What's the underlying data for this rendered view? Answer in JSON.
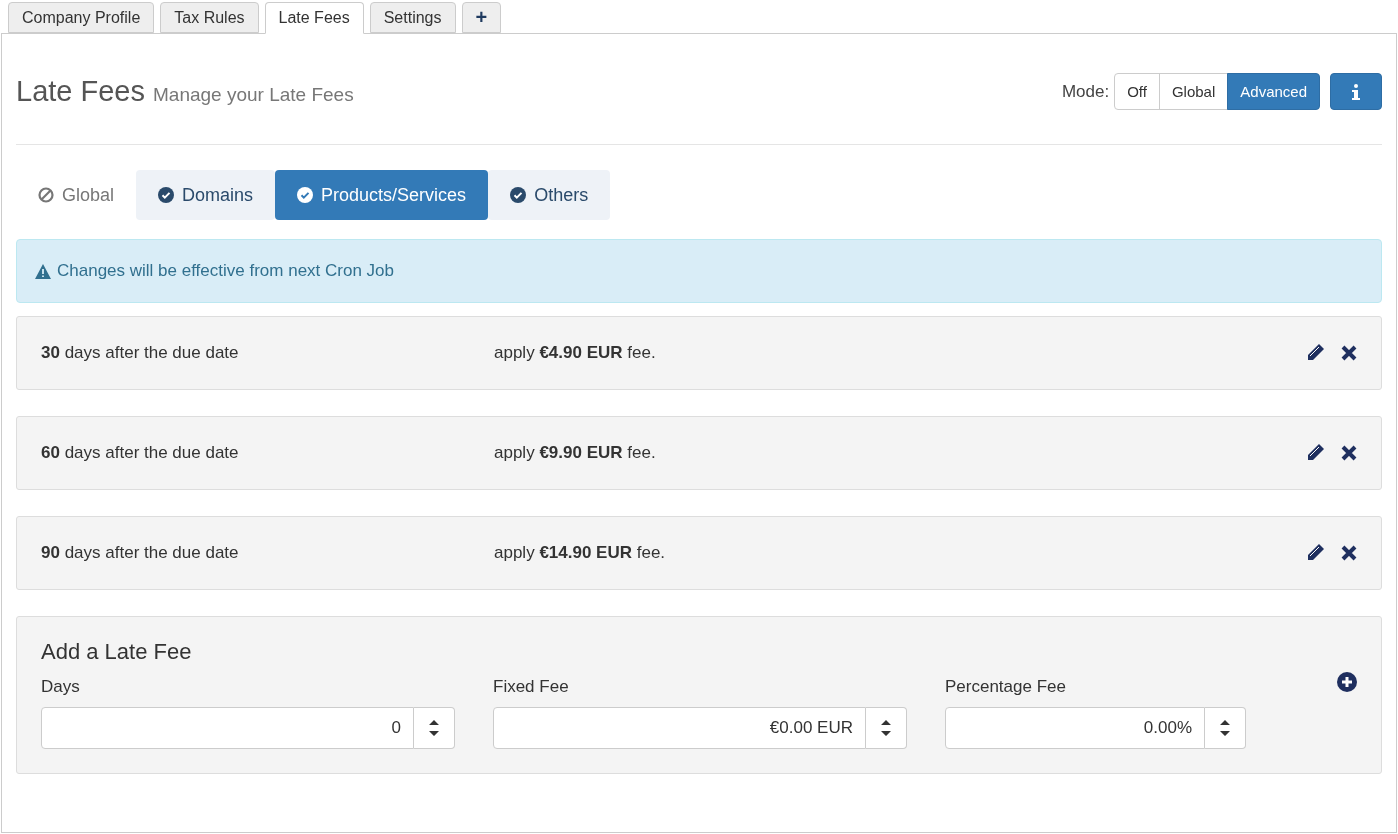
{
  "page_tabs": [
    {
      "label": "Company Profile",
      "selected": false
    },
    {
      "label": "Tax Rules",
      "selected": false
    },
    {
      "label": "Late Fees",
      "selected": true
    },
    {
      "label": "Settings",
      "selected": false
    },
    {
      "label": "+",
      "selected": false
    }
  ],
  "header": {
    "title": "Late Fees",
    "subtitle": "Manage your Late Fees",
    "mode_label": "Mode:",
    "modes": [
      {
        "label": "Off",
        "selected": false
      },
      {
        "label": "Global",
        "selected": false
      },
      {
        "label": "Advanced",
        "selected": true
      }
    ]
  },
  "sub_tabs": [
    {
      "label": "Global",
      "enabled": false,
      "selected": false
    },
    {
      "label": "Domains",
      "enabled": true,
      "selected": false
    },
    {
      "label": "Products/Services",
      "enabled": true,
      "selected": true
    },
    {
      "label": "Others",
      "enabled": true,
      "selected": false
    }
  ],
  "alert": "Changes will be effective from next Cron Job",
  "fees": [
    {
      "days": "**30** days after the due date",
      "fee": "apply **€4.90 EUR** fee."
    },
    {
      "days": "**60** days after the due date",
      "fee": "apply **€9.90 EUR** fee."
    },
    {
      "days": "**90** days after the due date",
      "fee": "apply **€14.90 EUR** fee."
    }
  ],
  "add_form": {
    "title": "Add a Late Fee",
    "fields": [
      {
        "label": "Days",
        "value": "0"
      },
      {
        "label": "Fixed Fee",
        "value": "€0.00 EUR"
      },
      {
        "label": "Percentage Fee",
        "value": "0.00%"
      }
    ]
  }
}
